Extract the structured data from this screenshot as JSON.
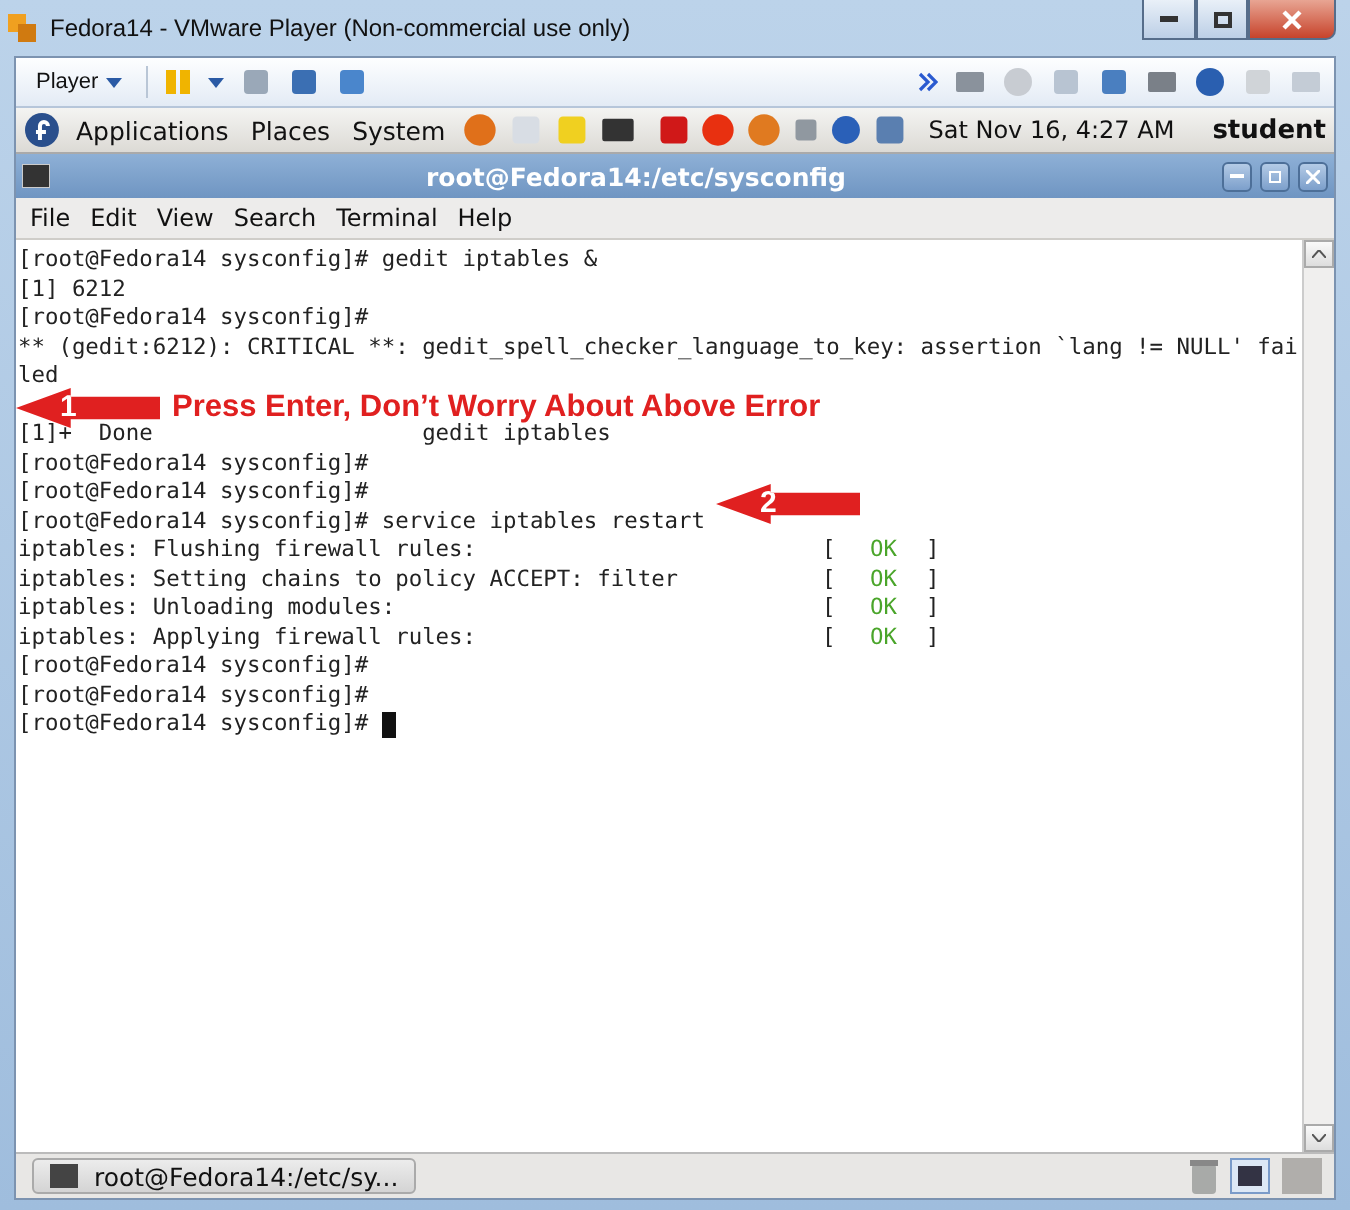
{
  "window": {
    "title": "Fedora14 - VMware Player (Non-commercial use only)"
  },
  "vm_toolbar": {
    "player_menu": "Player"
  },
  "panel": {
    "menus": [
      "Applications",
      "Places",
      "System"
    ],
    "clock": "Sat Nov 16,  4:27 AM",
    "user": "student"
  },
  "terminal": {
    "title": "root@Fedora14:/etc/sysconfig",
    "menu": [
      "File",
      "Edit",
      "View",
      "Search",
      "Terminal",
      "Help"
    ],
    "lines": [
      {
        "kind": "text",
        "text": "[root@Fedora14 sysconfig]# gedit iptables &"
      },
      {
        "kind": "text",
        "text": "[1] 6212"
      },
      {
        "kind": "text",
        "text": "[root@Fedora14 sysconfig]#"
      },
      {
        "kind": "text",
        "text": "** (gedit:6212): CRITICAL **: gedit_spell_checker_language_to_key: assertion `lang != NULL' fai"
      },
      {
        "kind": "text",
        "text": "led"
      },
      {
        "kind": "blank"
      },
      {
        "kind": "text",
        "text": "[1]+  Done                    gedit iptables"
      },
      {
        "kind": "text",
        "text": "[root@Fedora14 sysconfig]#"
      },
      {
        "kind": "text",
        "text": "[root@Fedora14 sysconfig]#"
      },
      {
        "kind": "text",
        "text": "[root@Fedora14 sysconfig]# service iptables restart"
      },
      {
        "kind": "status",
        "text": "iptables: Flushing firewall rules:",
        "open": "[",
        "status": "OK",
        "close": "]"
      },
      {
        "kind": "status",
        "text": "iptables: Setting chains to policy ACCEPT: filter",
        "open": "[",
        "status": "OK",
        "close": "]"
      },
      {
        "kind": "status",
        "text": "iptables: Unloading modules:",
        "open": "[",
        "status": "OK",
        "close": "]"
      },
      {
        "kind": "status",
        "text": "iptables: Applying firewall rules:",
        "open": "[",
        "status": "OK",
        "close": "]"
      },
      {
        "kind": "text",
        "text": "[root@Fedora14 sysconfig]#"
      },
      {
        "kind": "text",
        "text": "[root@Fedora14 sysconfig]#"
      },
      {
        "kind": "cursor",
        "text": "[root@Fedora14 sysconfig]# "
      }
    ]
  },
  "annotations": [
    {
      "number": "1",
      "text": "Press Enter, Don’t Worry About Above Error"
    },
    {
      "number": "2"
    }
  ],
  "taskbar": {
    "task": "root@Fedora14:/etc/sy..."
  }
}
